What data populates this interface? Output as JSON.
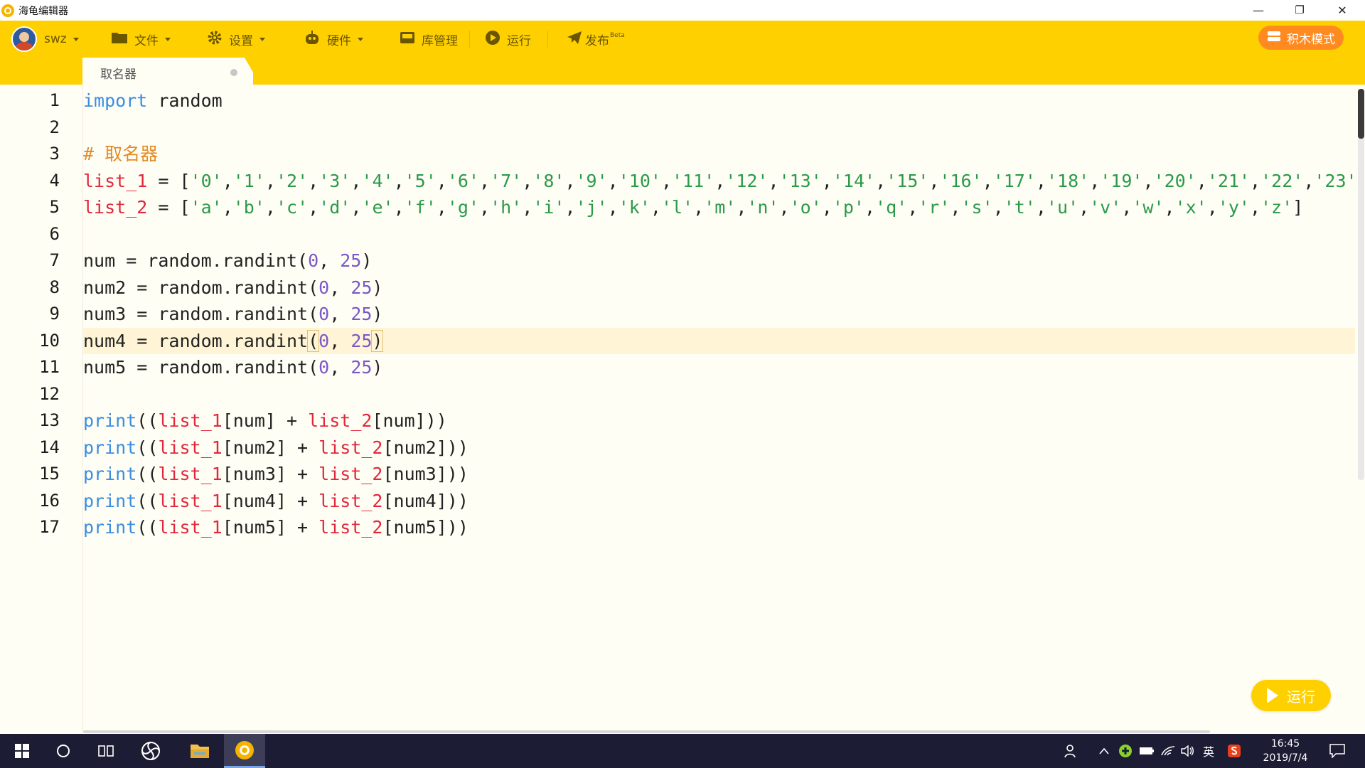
{
  "window": {
    "title": "海龟编辑器",
    "minimize": "—",
    "restore": "❐",
    "close": "✕"
  },
  "toolbar": {
    "user": "swz",
    "file": "文件",
    "settings": "设置",
    "hardware": "硬件",
    "library": "库管理",
    "run": "运行",
    "publish": "发布",
    "publish_badge": "Beta",
    "blocks_mode": "积木模式"
  },
  "tab": {
    "name": "取名器"
  },
  "editor": {
    "line_numbers": [
      "1",
      "2",
      "3",
      "4",
      "5",
      "6",
      "7",
      "8",
      "9",
      "10",
      "11",
      "12",
      "13",
      "14",
      "15",
      "16",
      "17"
    ],
    "active_line": 10
  },
  "run_button": {
    "label": "运行"
  },
  "taskbar": {
    "ime": "英",
    "time": "16:45",
    "date": "2019/7/4"
  },
  "colors": {
    "toolbar": "#ffd000",
    "keyword": "#3a8de0",
    "variable": "#e0273c",
    "string": "#2a9a4a",
    "number": "#7a58c8",
    "comment": "#e38b27"
  }
}
